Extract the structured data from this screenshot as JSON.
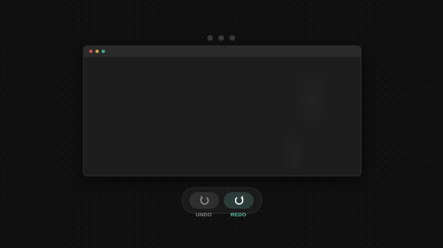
{
  "carousel": {
    "page_count": 3
  },
  "window": {
    "traffic_lights": [
      {
        "name": "close",
        "color": "#c2555a"
      },
      {
        "name": "minimize",
        "color": "#c9a64a"
      },
      {
        "name": "maximize",
        "color": "#45a48f"
      }
    ]
  },
  "history": {
    "undo": {
      "label": "UNDO",
      "icon": "undo-icon",
      "color": "#8a8a8a"
    },
    "redo": {
      "label": "REDO",
      "icon": "redo-icon",
      "color": "#5ec2ad"
    }
  },
  "colors": {
    "background": "#101010",
    "window": "#1d1d1d",
    "accent": "#5ec2ad"
  }
}
